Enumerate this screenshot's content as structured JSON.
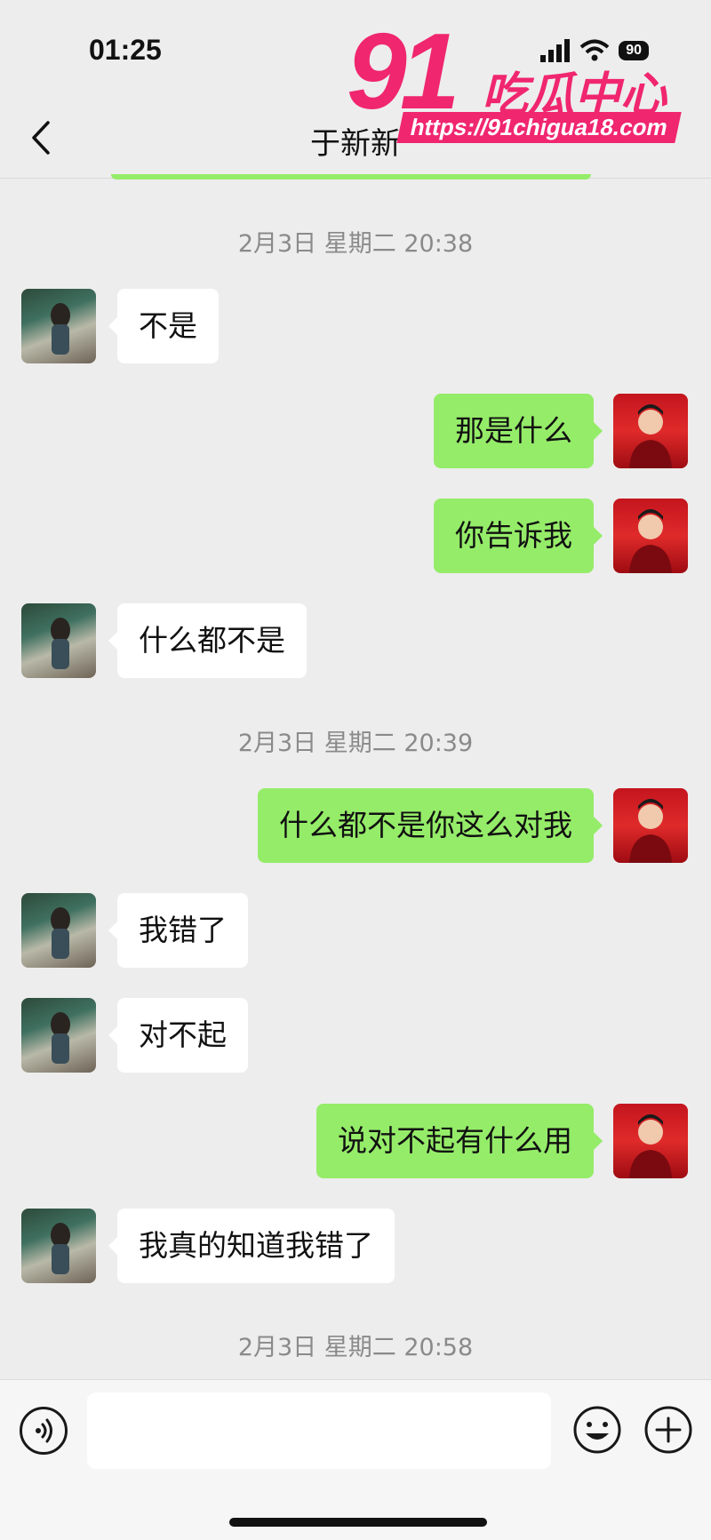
{
  "status_bar": {
    "time": "01:25",
    "battery": "90"
  },
  "chat": {
    "title": "于新新"
  },
  "watermark": {
    "number": "91",
    "text": "吃瓜中心",
    "url": "https://91chigua18.com"
  },
  "timestamps": [
    "2月3日 星期二 20:38",
    "2月3日 星期二 20:39",
    "2月3日 星期二 20:58"
  ],
  "messages": [
    {
      "from": "contact",
      "text": "不是"
    },
    {
      "from": "me",
      "text": "那是什么"
    },
    {
      "from": "me",
      "text": "你告诉我"
    },
    {
      "from": "contact",
      "text": "什么都不是"
    },
    {
      "from": "me",
      "text": "什么都不是你这么对我"
    },
    {
      "from": "contact",
      "text": "我错了"
    },
    {
      "from": "contact",
      "text": "对不起"
    },
    {
      "from": "me",
      "text": "说对不起有什么用"
    },
    {
      "from": "contact",
      "text": "我真的知道我错了"
    }
  ],
  "input": {
    "value": "",
    "placeholder": ""
  },
  "icons": {
    "back": "chevron-left-icon",
    "voice": "voice-icon",
    "emoji": "emoji-icon",
    "plus": "plus-icon",
    "signal": "signal-icon",
    "wifi": "wifi-icon",
    "battery": "battery-icon"
  },
  "colors": {
    "background": "#ededed",
    "outgoing_bubble": "#95ec69",
    "incoming_bubble": "#ffffff",
    "watermark": "#f0266f"
  }
}
